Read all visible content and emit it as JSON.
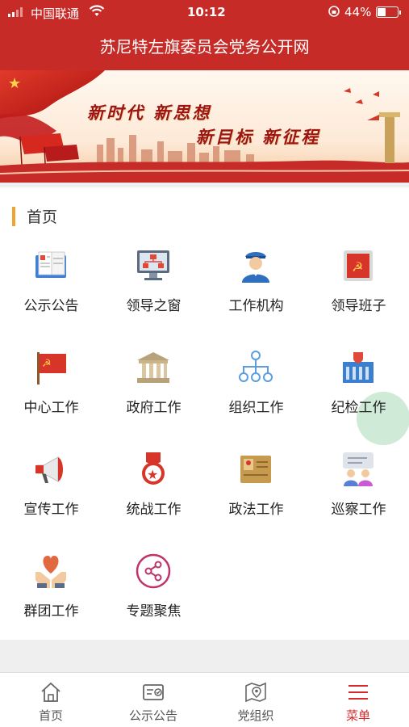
{
  "status_bar": {
    "carrier": "中国联通",
    "time": "10:12",
    "battery": "44%",
    "battery_level": 0.44
  },
  "header": {
    "title": "苏尼特左旗委员会党务公开网"
  },
  "banner": {
    "line1": "新时代 新思想",
    "line2": "新目标 新征程"
  },
  "section": {
    "title": "首页"
  },
  "grid": {
    "items": [
      {
        "label": "公示公告",
        "icon": "notice-book-icon"
      },
      {
        "label": "领导之窗",
        "icon": "org-monitor-icon"
      },
      {
        "label": "工作机构",
        "icon": "officer-icon"
      },
      {
        "label": "领导班子",
        "icon": "party-book-icon"
      },
      {
        "label": "中心工作",
        "icon": "party-flag-icon"
      },
      {
        "label": "政府工作",
        "icon": "government-building-icon"
      },
      {
        "label": "组织工作",
        "icon": "hierarchy-icon"
      },
      {
        "label": "纪检工作",
        "icon": "shield-building-icon"
      },
      {
        "label": "宣传工作",
        "icon": "megaphone-icon"
      },
      {
        "label": "统战工作",
        "icon": "star-medal-icon"
      },
      {
        "label": "政法工作",
        "icon": "law-document-icon"
      },
      {
        "label": "巡察工作",
        "icon": "inspection-people-icon"
      },
      {
        "label": "群团工作",
        "icon": "heart-hands-icon"
      },
      {
        "label": "专题聚焦",
        "icon": "share-circle-icon"
      }
    ]
  },
  "bottom_nav": {
    "items": [
      {
        "label": "首页",
        "icon": "home-icon"
      },
      {
        "label": "公示公告",
        "icon": "notice-icon"
      },
      {
        "label": "党组织",
        "icon": "map-pin-icon"
      },
      {
        "label": "菜单",
        "icon": "menu-icon"
      }
    ],
    "active_index": 3
  },
  "colors": {
    "brand_red": "#c72b27",
    "accent_orange": "#f2a52e",
    "active_nav": "#d82a2a"
  }
}
